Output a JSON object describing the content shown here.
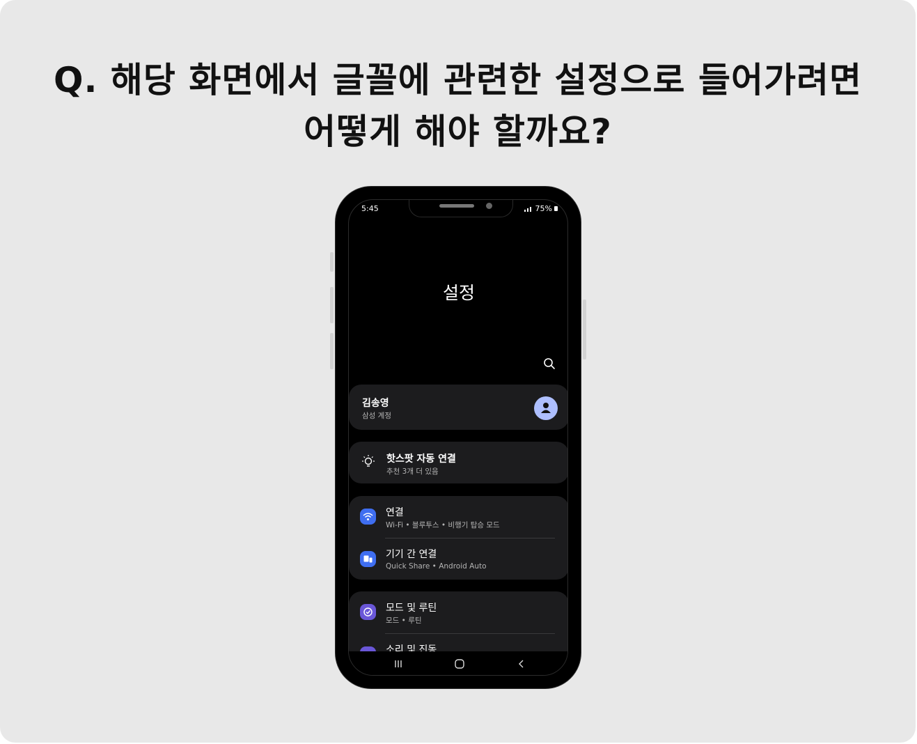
{
  "question": {
    "line1": "Q. 해당 화면에서 글꼴에 관련한 설정으로 들어가려면",
    "line2": "어떻게 해야 할까요?"
  },
  "status_bar": {
    "time": "5:45",
    "battery": "75%"
  },
  "screen_title": "설정",
  "icons": {
    "search": "search-icon",
    "avatar": "avatar-icon"
  },
  "account": {
    "name": "김송영",
    "subtitle": "삼성 계정"
  },
  "hotspot_suggestion": {
    "title": "핫스팟 자동 연결",
    "subtitle": "추천 3개 더 있음"
  },
  "settings_items": [
    {
      "label": "연결",
      "sub": "Wi-Fi • 블루투스 • 비행기 탑승 모드"
    },
    {
      "label": "기기 간 연결",
      "sub": "Quick Share • Android Auto"
    },
    {
      "label": "모드 및 루틴",
      "sub": "모드 • 루틴"
    },
    {
      "label": "소리 및 진동",
      "sub": ""
    }
  ],
  "colors": {
    "background": "#e8e8e8",
    "card": "#1c1c1e",
    "blue_icon": "#3f6ef0",
    "purple_icon": "#6a57d8"
  }
}
